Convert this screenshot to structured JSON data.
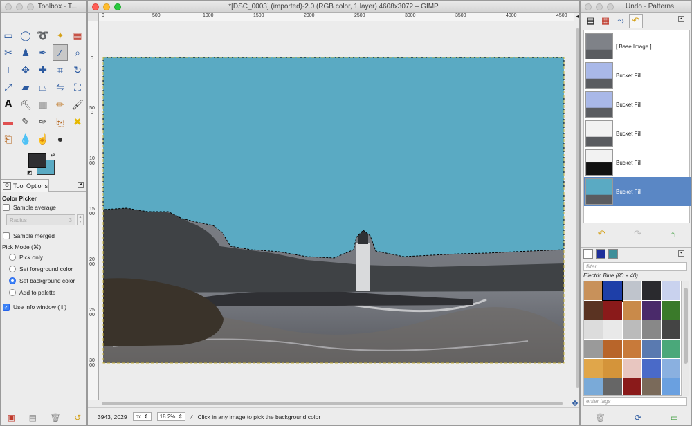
{
  "toolbox": {
    "title": "Toolbox - T...",
    "tool_options_tab": "Tool Options",
    "section_title": "Color Picker",
    "sample_average_label": "Sample average",
    "radius_label": "Radius",
    "radius_value": "3",
    "sample_merged_label": "Sample merged",
    "pick_mode_label": "Pick Mode  (⌘)",
    "pick_only_label": "Pick only",
    "set_foreground_label": "Set foreground color",
    "set_background_label": "Set background color",
    "add_to_palette_label": "Add to palette",
    "use_info_window_label": "Use info window  (⇧)",
    "fg_color": "#2f2f32",
    "bg_color": "#5aaac3"
  },
  "image_window": {
    "title": "*[DSC_0003] (imported)-2.0 (RGB color, 1 layer) 4608x3072 – GIMP",
    "ruler_top_labels": [
      "0",
      "500",
      "1000",
      "1500",
      "2000",
      "2500",
      "3000",
      "3500",
      "4000",
      "4500"
    ],
    "ruler_left_labels": [
      "0",
      "500",
      "1000",
      "1500",
      "2000",
      "2500",
      "3000"
    ],
    "status": {
      "coords": "3943, 2029",
      "unit": "px",
      "zoom": "18.2%",
      "message": "Click in any image to pick the background color"
    },
    "sky_color": "#5aaac3"
  },
  "dock": {
    "title": "Undo - Patterns",
    "undo_items": [
      {
        "label": "[ Base Image ]",
        "selected": false
      },
      {
        "label": "Bucket Fill",
        "selected": false
      },
      {
        "label": "Bucket Fill",
        "selected": false
      },
      {
        "label": "Bucket Fill",
        "selected": false
      },
      {
        "label": "Bucket Fill",
        "selected": false
      },
      {
        "label": "Bucket Fill",
        "selected": true
      }
    ],
    "pattern_filter_placeholder": "filter",
    "pattern_name": "Electric Blue  (80 × 40)",
    "tags_placeholder": "enter tags"
  }
}
